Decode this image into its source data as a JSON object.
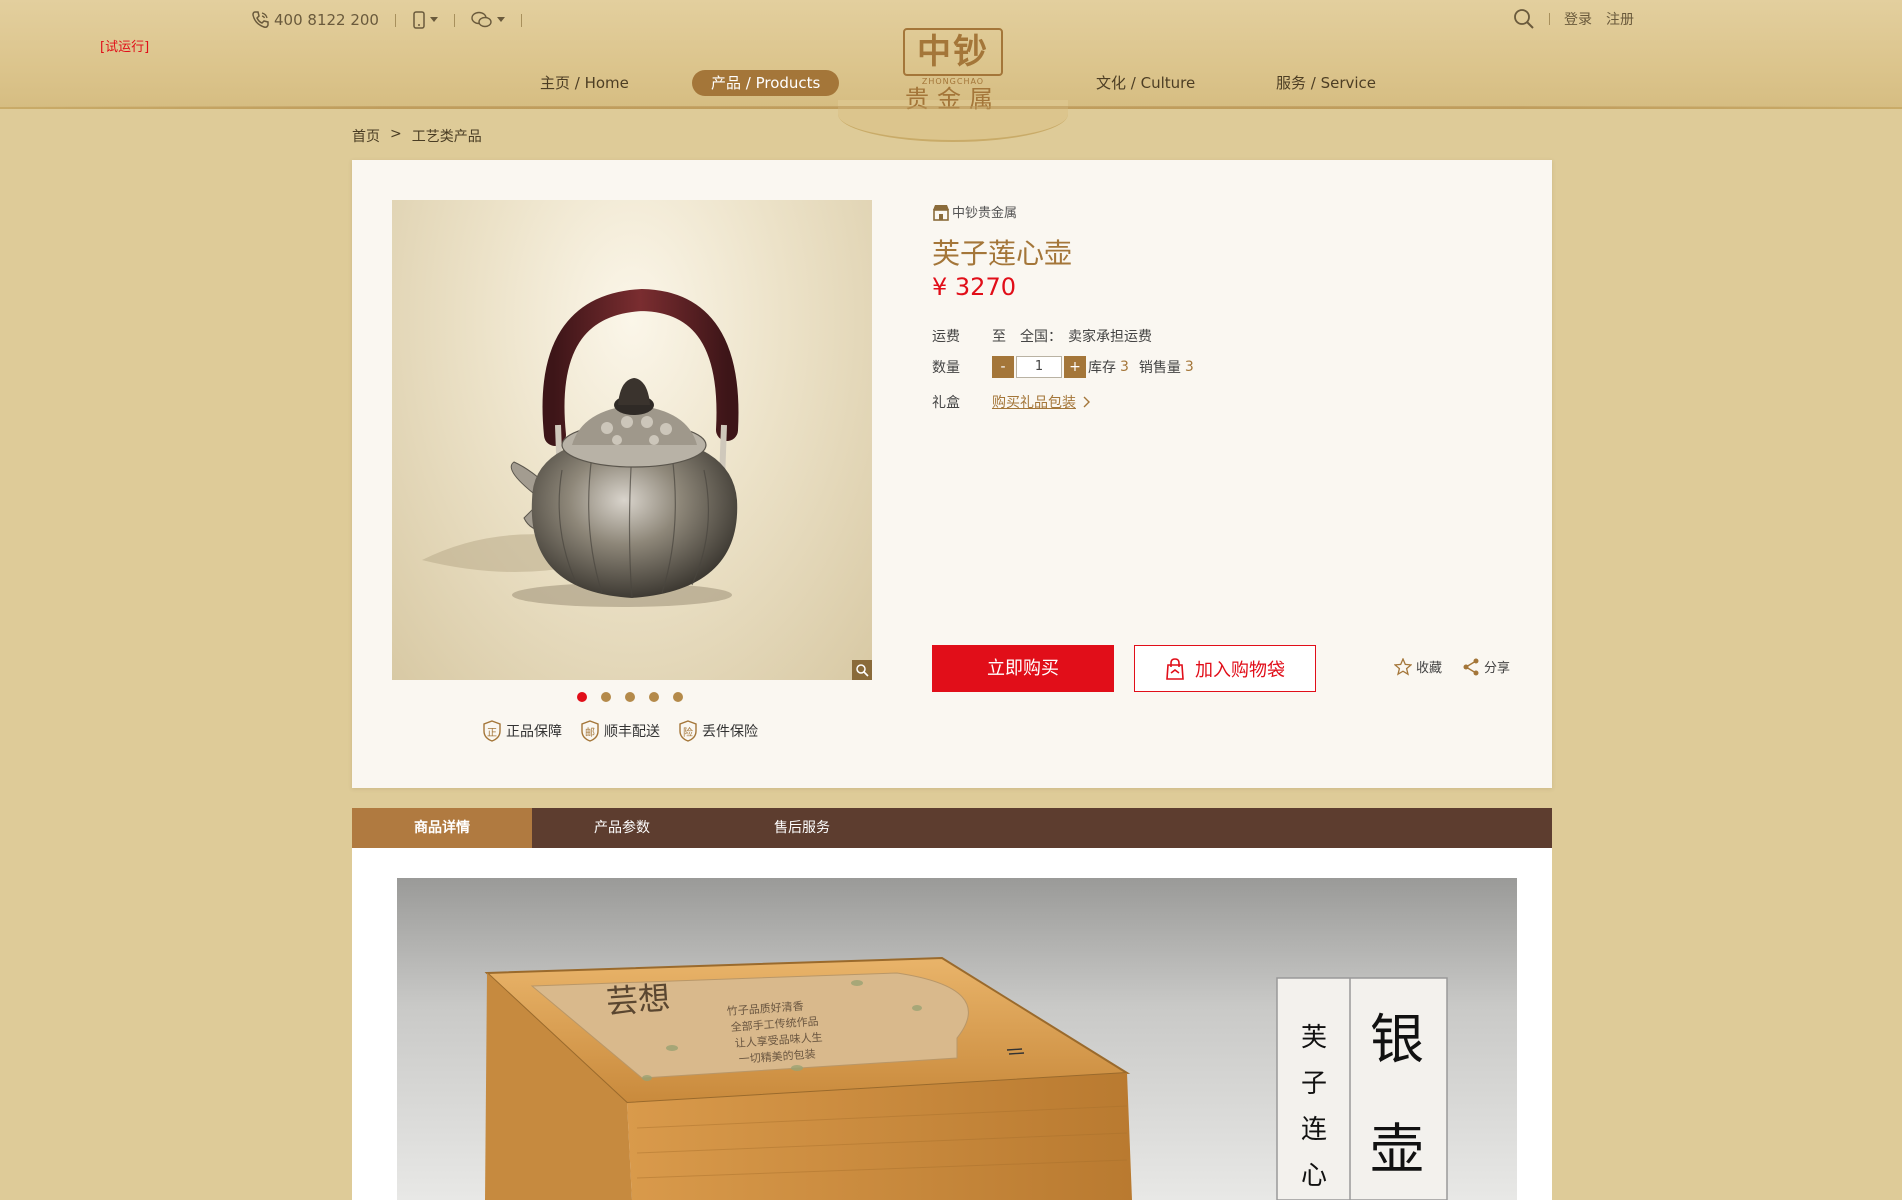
{
  "header": {
    "trial_label": "[试运行]",
    "phone": "400 8122 200",
    "login": "登录",
    "register": "注册",
    "nav": [
      "主页 / Home",
      "产品 / Products",
      "文化 / Culture",
      "服务 / Service"
    ],
    "logo": {
      "mark": "中钞",
      "pinyin": "ZHONGCHAO",
      "name": "贵金属"
    }
  },
  "breadcrumb": {
    "home": "首页",
    "sep": ">",
    "current": "工艺类产品"
  },
  "product": {
    "shop": "中钞贵金属",
    "title": "芙子莲心壶",
    "price": "¥ 3270",
    "shipping_label": "运费",
    "shipping_to": "至",
    "shipping_region": "全国：",
    "shipping_value": "卖家承担运费",
    "qty_label": "数量",
    "qty_minus": "-",
    "qty_value": "1",
    "qty_plus": "+",
    "stock_label": "库存",
    "stock_value": "3",
    "sold_label": "销售量",
    "sold_value": "3",
    "gift_label": "礼盒",
    "gift_link": "购买礼品包装",
    "buy_now": "立即购买",
    "add_cart": "加入购物袋",
    "favorite": "收藏",
    "share": "分享",
    "image_count": 5,
    "active_image": 1
  },
  "guarantees": [
    {
      "badge": "正",
      "label": "正品保障"
    },
    {
      "badge": "邮",
      "label": "顺丰配送"
    },
    {
      "badge": "险",
      "label": "丢件保险"
    }
  ],
  "tabs": [
    "商品详情",
    "产品参数",
    "售后服务"
  ],
  "detail_image": {
    "card_title": "芸想",
    "card_text": [
      "竹子品质好清香",
      "全部手工传统作品",
      "让人享受品味人生",
      "一切精美的包装"
    ],
    "big_chars": [
      "银",
      "壶"
    ],
    "small_chars": [
      "芙",
      "子",
      "连",
      "心"
    ]
  },
  "colors": {
    "accent": "#a47639",
    "red": "#e10e19",
    "tabbar": "#5d3d2f"
  }
}
